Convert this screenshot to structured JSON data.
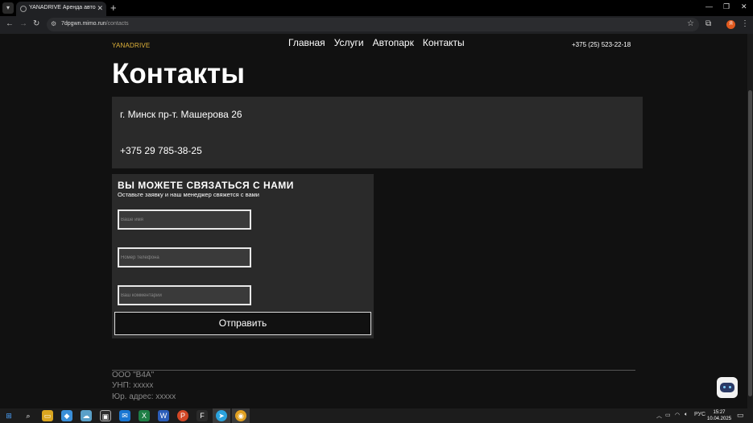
{
  "browser": {
    "tab_title": "YANADRIVE Аренда авто",
    "url_host": "7dpgwn.mimo.run",
    "url_path": "/contacts",
    "profile_initial": "Я"
  },
  "site": {
    "logo": "YANADRIVE",
    "menu": [
      "Главная",
      "Услуги",
      "Автопарк",
      "Контакты"
    ],
    "header_phone": "+375 (25) 523-22-18"
  },
  "contacts": {
    "title": "Контакты",
    "address": "г. Минск пр-т. Машерова 26",
    "phone": "+375 29 785-38-25"
  },
  "form": {
    "title": "ВЫ МОЖЕТЕ СВЯЗАТЬСЯ С НАМИ",
    "subtitle": "Оставьте заявку и наш менеджер свяжется с вами",
    "name_placeholder": "Ваше имя",
    "phone_placeholder": "Номер телефона",
    "comment_placeholder": "Ваш комментарий",
    "submit_label": "Отправить"
  },
  "footer": {
    "company": "ООО \"В4А\"",
    "unp": "УНП: xxxxx",
    "legal_address": "Юр. адрес: xxxxx"
  },
  "taskbar": {
    "lang": "РУС",
    "time": "15:27",
    "date": "10.04.2025"
  },
  "colors": {
    "logo": "#e0b33a",
    "page_bg": "#111111",
    "panel_bg": "#2a2a2a"
  }
}
